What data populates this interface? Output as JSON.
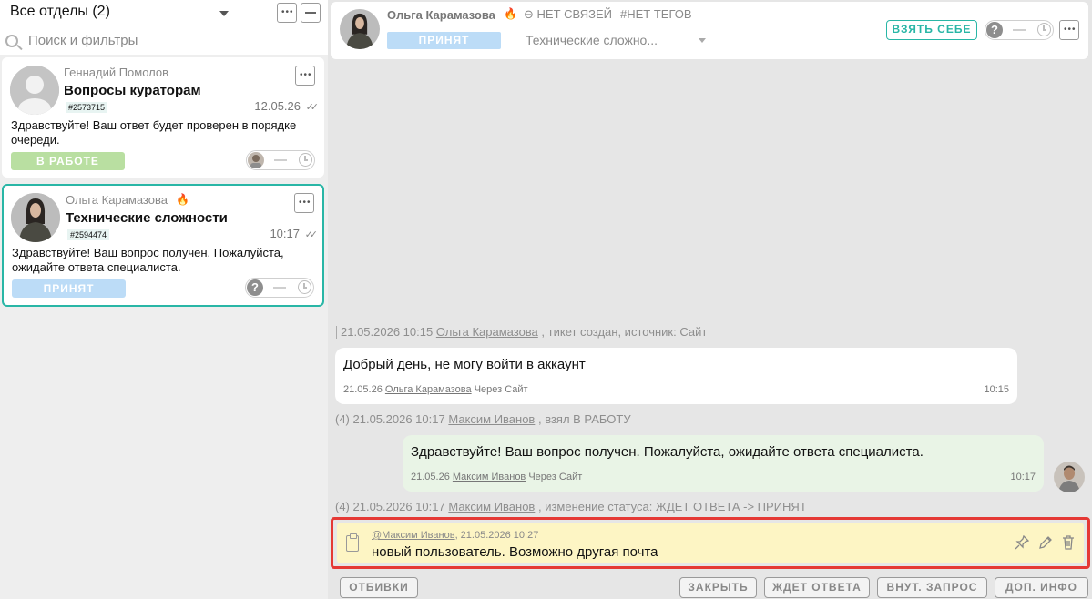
{
  "left": {
    "department_title": "Все отделы (2)",
    "search_placeholder": "Поиск и фильтры",
    "tickets": [
      {
        "name": "Геннадий Помолов",
        "subject": "Вопросы кураторам",
        "ticket_id": "#2573715",
        "date": "12.05.26",
        "checks": "✓✓",
        "text": "Здравствуйте! Ваш ответ будет проверен в порядке очереди.",
        "status": "В РАБОТЕ"
      },
      {
        "name": "Ольга Карамазова",
        "subject": "Технические сложности",
        "ticket_id": "#2594474",
        "date": "10:17",
        "checks": "✓✓",
        "text": "Здравствуйте! Ваш вопрос получен. Пожалуйста, ожидайте ответа специалиста.",
        "status": "ПРИНЯТ",
        "assignee_unknown": "?"
      }
    ]
  },
  "header": {
    "name": "Ольга Карамазова",
    "links": "НЕТ СВЯЗЕЙ",
    "tags": "#НЕТ ТЕГОВ",
    "status": "ПРИНЯТ",
    "category": "Технические сложно...",
    "take_button": "ВЗЯТЬ СЕБЕ",
    "assignee_unknown": "?"
  },
  "chat": {
    "sys1": {
      "date": "21.05.2026 10:15",
      "user": "Ольга Карамазова",
      "text": ", тикет создан, источник: Сайт"
    },
    "msg1": {
      "text": "Добрый день, не могу войти в аккаунт",
      "date": "21.05.26",
      "user": "Ольга Карамазова",
      "source": "Через Сайт",
      "time": "10:15"
    },
    "sys2": {
      "prefix": "(4) 21.05.2026 10:17",
      "user": "Максим Иванов",
      "text": ", взял В РАБОТУ"
    },
    "msg2": {
      "text": "Здравствуйте! Ваш вопрос получен. Пожалуйста, ожидайте ответа специалиста.",
      "date": "21.05.26",
      "user": "Максим Иванов",
      "source": "Через Сайт",
      "time": "10:17"
    },
    "sys3": {
      "prefix": "(4) 21.05.2026 10:17",
      "user": "Максим Иванов",
      "text": ", изменение статуса: ЖДЕТ ОТВЕТА -> ПРИНЯТ"
    },
    "note": {
      "mention": "@Максим Иванов",
      "datetime": ", 21.05.2026 10:27",
      "text": "новый пользователь. Возможно другая почта"
    }
  },
  "bottom": {
    "otbivki": "ОТБИВКИ",
    "close": "ЗАКРЫТЬ",
    "waiting": "ЖДЕТ ОТВЕТА",
    "internal": "ВНУТ. ЗАПРОС",
    "info": "ДОП. ИНФО"
  },
  "colors": {
    "accent": "#29b6a6",
    "status_work": "#b9dfa1",
    "status_accepted": "#bcdcf7",
    "note_bg": "#fdf5c4",
    "note_border": "#e53935"
  }
}
